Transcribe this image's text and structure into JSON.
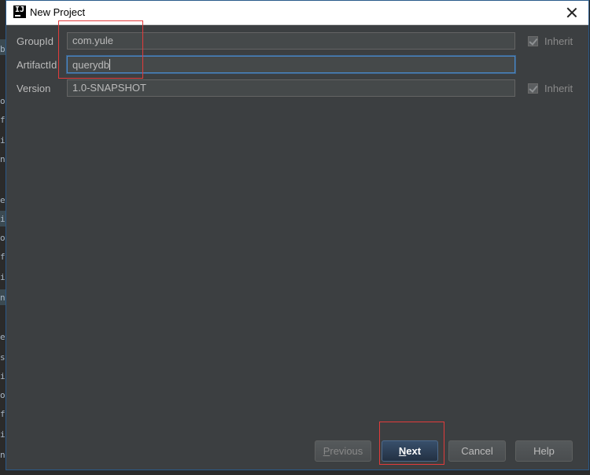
{
  "window": {
    "title": "New Project",
    "icon": "intellij-idea-icon"
  },
  "form": {
    "group_id": {
      "label": "GroupId",
      "value": "com.yule",
      "inherit_label": "Inherit",
      "inherit_checked": true
    },
    "artifact_id": {
      "label": "ArtifactId",
      "value": "querydb"
    },
    "version": {
      "label": "Version",
      "value": "1.0-SNAPSHOT",
      "inherit_label": "Inherit",
      "inherit_checked": true
    }
  },
  "buttons": {
    "previous": {
      "first": "P",
      "rest": "revious"
    },
    "next": {
      "first": "N",
      "rest": "ext"
    },
    "cancel": "Cancel",
    "help": "Help"
  },
  "background_editor": {
    "chars": [
      "b",
      "o",
      "fa",
      "ic",
      "ne",
      "e",
      "ic",
      "o",
      "fa",
      "ic",
      "ne",
      "e",
      "s",
      "ic",
      "o",
      "fa",
      "ic",
      "ne"
    ]
  },
  "colors": {
    "dialog_bg": "#3c3f41",
    "field_bg": "#45494a",
    "focus_border": "#4a88c7",
    "annotation_red": "#e23b3b"
  }
}
